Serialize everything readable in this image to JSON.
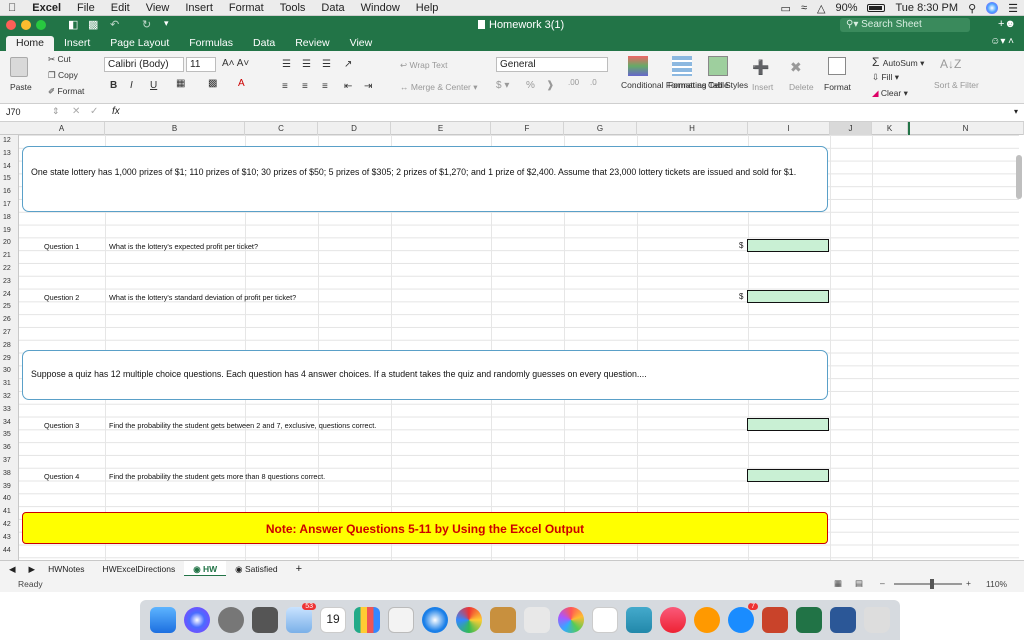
{
  "menubar": {
    "apple": "",
    "items": [
      "Excel",
      "File",
      "Edit",
      "View",
      "Insert",
      "Format",
      "Tools",
      "Data",
      "Window",
      "Help"
    ],
    "battery": "90%",
    "clock": "Tue 8:30 PM"
  },
  "window": {
    "title": "Homework 3(1)",
    "search_placeholder": "Search Sheet"
  },
  "ribbon_tabs": [
    "Home",
    "Insert",
    "Page Layout",
    "Formulas",
    "Data",
    "Review",
    "View"
  ],
  "ribbon": {
    "paste": "Paste",
    "cut": "Cut",
    "copy": "Copy",
    "format": "Format",
    "font_name": "Calibri (Body)",
    "font_size": "11",
    "bold": "B",
    "italic": "I",
    "underline": "U",
    "wrap_text": "Wrap Text",
    "merge_center": "Merge & Center",
    "number_format": "General",
    "conditional_formatting": "Conditional Formatting",
    "format_as_table": "Format as Table",
    "cell_styles": "Cell Styles",
    "insert": "Insert",
    "delete": "Delete",
    "format_cells": "Format",
    "autosum": "AutoSum",
    "fill": "Fill",
    "clear": "Clear",
    "sort_filter": "Sort & Filter"
  },
  "formula_bar": {
    "cell_ref": "J70",
    "fx": "fx"
  },
  "columns": [
    "A",
    "B",
    "C",
    "D",
    "E",
    "F",
    "G",
    "H",
    "I",
    "J",
    "K",
    "N"
  ],
  "rows": [
    "12",
    "13",
    "14",
    "15",
    "16",
    "17",
    "18",
    "19",
    "20",
    "21",
    "22",
    "23",
    "24",
    "25",
    "26",
    "27",
    "28",
    "29",
    "30",
    "31",
    "32",
    "33",
    "34",
    "35",
    "36",
    "37",
    "38",
    "39",
    "40",
    "41",
    "42",
    "43",
    "44"
  ],
  "content": {
    "problem1": "One state lottery has 1,000 prizes of $1; 110 prizes of $10; 30 prizes of $50; 5 prizes of $305; 2 prizes of $1,270; and 1 prize of $2,400. Assume that 23,000 lottery tickets are issued and sold for $1.",
    "q1_label": "Question 1",
    "q1_text": "What is the lottery's expected profit per ticket?",
    "q2_label": "Question 2",
    "q2_text": "What is the lottery's standard deviation of profit per ticket?",
    "dollar": "$",
    "problem2": "Suppose a quiz has 12 multiple choice questions. Each question has 4 answer choices. If a student takes the quiz and randomly guesses on every question....",
    "q3_label": "Question 3",
    "q3_text": "Find the probability the student gets between 2 and 7, exclusive, questions correct.",
    "q4_label": "Question 4",
    "q4_text": "Find the probability the student gets more than 8 questions correct.",
    "note": "Note: Answer Questions 5-11 by Using the Excel Output"
  },
  "sheet_tabs": [
    "HWNotes",
    "HWExcelDirections",
    "HW",
    "Satisfied",
    "+"
  ],
  "status": {
    "ready": "Ready",
    "zoom": "110%"
  },
  "dock": {
    "calendar_day": "19",
    "mail_badge": "53",
    "appstore_badge": "7"
  }
}
